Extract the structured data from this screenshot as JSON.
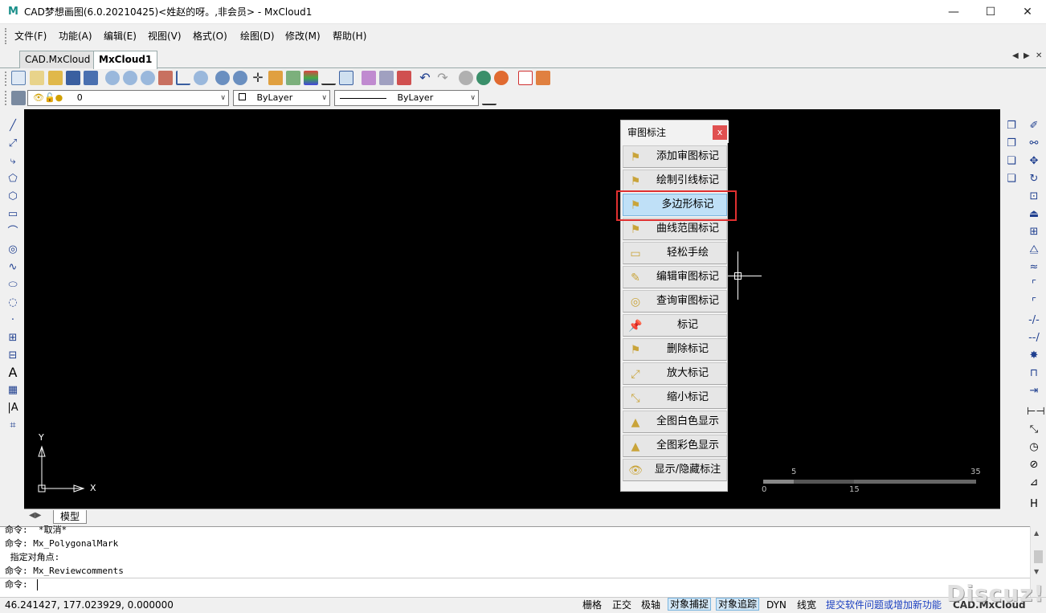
{
  "window": {
    "title": "CAD梦想画图(6.0.20210425)<姓赵的呀。,非会员> - MxCloud1",
    "app_icon_glyph": "M",
    "minimize": "—",
    "maximize": "☐",
    "close": "✕"
  },
  "menu": [
    "文件(F)",
    "功能(A)",
    "编辑(E)",
    "视图(V)",
    "格式(O)",
    "绘图(D)",
    "修改(M)",
    "帮助(H)"
  ],
  "tabs": [
    {
      "label": "CAD.MxCloud",
      "active": false
    },
    {
      "label": "MxCloud1",
      "active": true
    }
  ],
  "tab_nav": [
    "◀",
    "▶",
    "✕"
  ],
  "layer_toolbar": {
    "layer_value": "0",
    "color_value": "ByLayer",
    "linetype_value": "ByLayer"
  },
  "panel": {
    "title": "审图标注",
    "close": "x",
    "items": [
      {
        "label": "添加审图标记",
        "icon": "flag-icon",
        "glyph": "⚑",
        "selected": false
      },
      {
        "label": "绘制引线标记",
        "icon": "leader-flag-icon",
        "glyph": "⚑",
        "selected": false
      },
      {
        "label": "多边形标记",
        "icon": "polygon-flag-icon",
        "glyph": "⚑",
        "selected": true
      },
      {
        "label": "曲线范围标记",
        "icon": "curve-flag-icon",
        "glyph": "⚑",
        "selected": false
      },
      {
        "label": "轻松手绘",
        "icon": "freehand-icon",
        "glyph": "▭",
        "selected": false
      },
      {
        "label": "编辑审图标记",
        "icon": "edit-icon",
        "glyph": "✎",
        "selected": false
      },
      {
        "label": "查询审图标记",
        "icon": "query-icon",
        "glyph": "◎",
        "selected": false
      },
      {
        "label": "标记",
        "icon": "pin-icon",
        "glyph": "📌",
        "selected": false
      },
      {
        "label": "删除标记",
        "icon": "delete-flag-icon",
        "glyph": "⚑",
        "selected": false
      },
      {
        "label": "放大标记",
        "icon": "zoom-in-icon",
        "glyph": "⤢",
        "selected": false
      },
      {
        "label": "缩小标记",
        "icon": "zoom-out-icon",
        "glyph": "⤡",
        "selected": false
      },
      {
        "label": "全图白色显示",
        "icon": "white-display-icon",
        "glyph": "▲",
        "selected": false
      },
      {
        "label": "全图彩色显示",
        "icon": "color-display-icon",
        "glyph": "▲",
        "selected": false
      },
      {
        "label": "显示/隐藏标注",
        "icon": "eye-icon",
        "glyph": "👁",
        "selected": false
      }
    ]
  },
  "canvas": {
    "ucs_x": "X",
    "ucs_y": "Y",
    "scale_labels_top": [
      "5",
      "35"
    ],
    "scale_labels_bottom": [
      "0",
      "15"
    ]
  },
  "bottom_tab": "模型",
  "command": {
    "lines": [
      "命令:  *取消*",
      "命令: Mx_PolygonalMark",
      " 指定对角点:",
      "命令: Mx_Reviewcomments"
    ],
    "prompt": "命令:"
  },
  "status": {
    "coords": "46.241427,  177.023929,  0.000000",
    "toggles": [
      {
        "label": "栅格",
        "on": false
      },
      {
        "label": "正交",
        "on": false
      },
      {
        "label": "极轴",
        "on": false
      },
      {
        "label": "对象捕捉",
        "on": true
      },
      {
        "label": "对象追踪",
        "on": true
      },
      {
        "label": "DYN",
        "on": false
      },
      {
        "label": "线宽",
        "on": false
      }
    ],
    "link": "提交软件问题或增加新功能",
    "brand": "CAD.MxCloud",
    "watermark": "Discuz!"
  },
  "colors": {
    "canvas": "#000000",
    "selected_item": "#bfe0f7",
    "highlight_box": "#e03030",
    "link": "#1a3fc0"
  }
}
